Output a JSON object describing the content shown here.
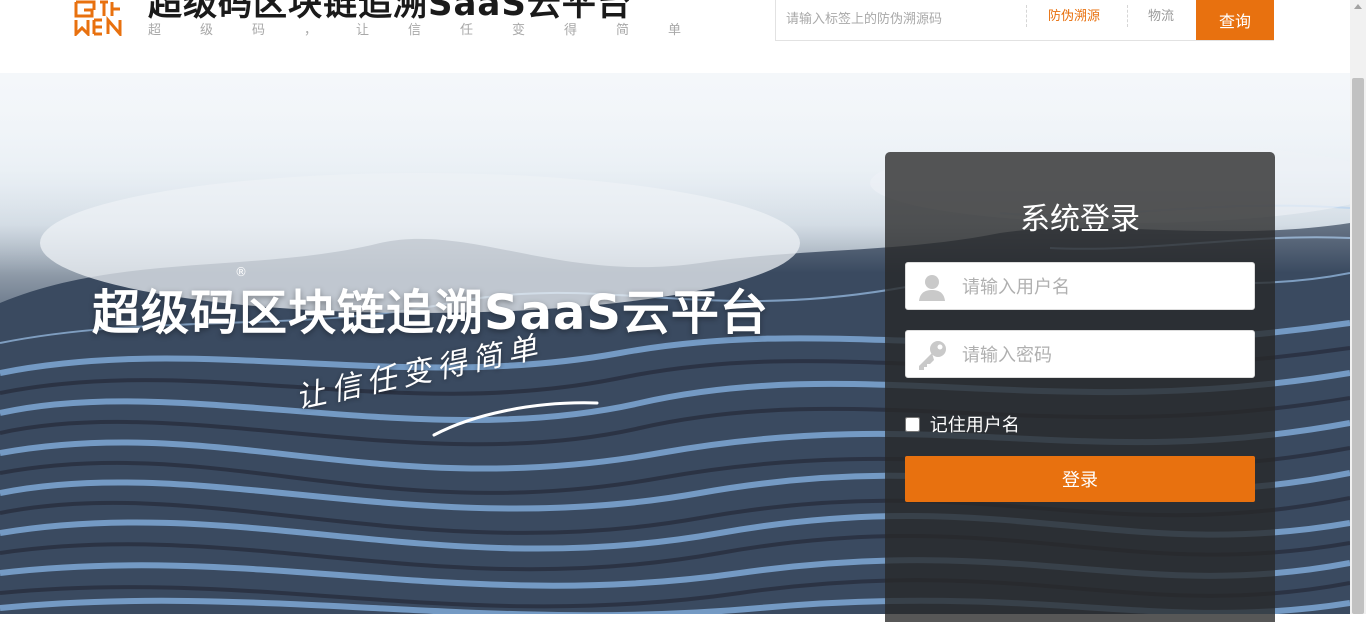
{
  "header": {
    "logo_icon": "guwen-logo",
    "brand_title": "超级码区块链追溯SaaS云平台",
    "brand_slogan": "超级码，让信任变得简单",
    "search": {
      "placeholder": "请输入标签上的防伪溯源码",
      "tabs": [
        "防伪溯源",
        "物流"
      ],
      "active_tab": "防伪溯源",
      "button_label": "查询"
    }
  },
  "hero": {
    "title": "超级码区块链追溯SaaS云平台",
    "registered_mark": "®",
    "slogan": "让信任变得简单"
  },
  "login": {
    "title": "系统登录",
    "username_placeholder": "请输入用户名",
    "password_placeholder": "请输入密码",
    "remember_label": "记住用户名",
    "remember_checked": false,
    "submit_label": "登录",
    "username_icon": "user-icon",
    "password_icon": "key-icon"
  },
  "colors": {
    "accent": "#e8710f",
    "panel_bg": "rgba(40,40,40,0.78)",
    "title_text": "#1a1a1a",
    "muted_text": "#a8a8a8"
  }
}
